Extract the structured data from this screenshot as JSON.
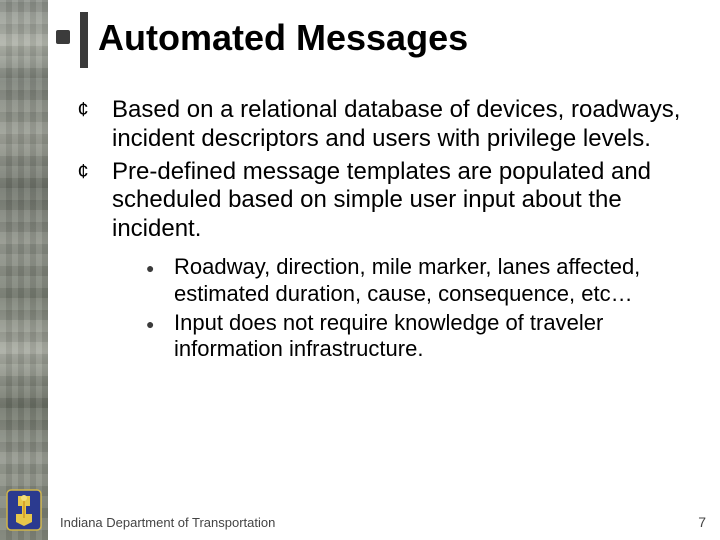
{
  "title": "Automated Messages",
  "bullets": {
    "level1": [
      "Based on a relational database of devices, roadways, incident descriptors and users with privilege levels.",
      "Pre-defined message templates are populated and scheduled based on simple user input about the incident."
    ],
    "level2": [
      "Roadway, direction, mile marker, lanes affected, estimated duration, cause, consequence, etc…",
      "Input does not require knowledge of traveler information infrastructure."
    ]
  },
  "footer": "Indiana Department of Transportation",
  "page_number": "7",
  "logo": {
    "outer_fill": "#2b3a8f",
    "state_fill": "#e8c84a",
    "torch_fill": "#d9a32a"
  }
}
